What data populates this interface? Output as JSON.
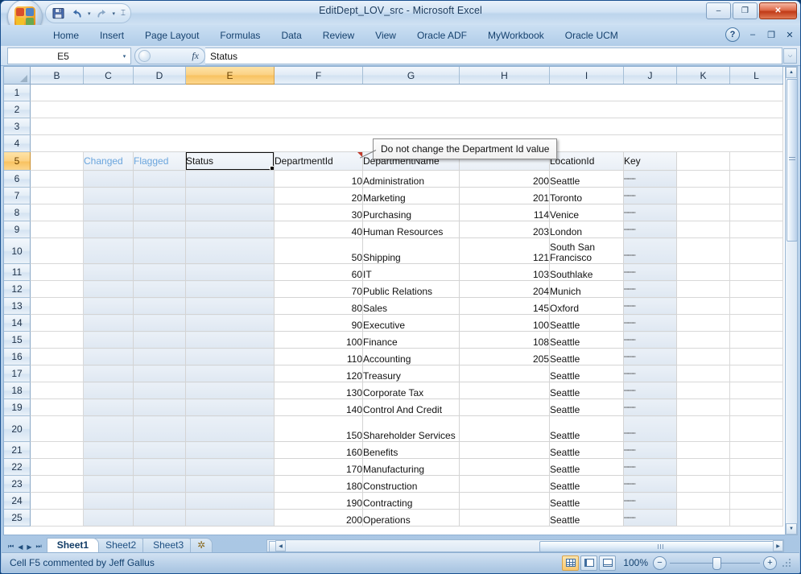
{
  "window": {
    "title": "EditDept_LOV_src - Microsoft Excel",
    "minimize_label": "–",
    "restore_label": "❐",
    "close_label": "✕"
  },
  "quick_access": {
    "office_button": "Office",
    "save_label": "💾",
    "undo_label": "↶",
    "redo_label": "↷",
    "caret_label": "▾",
    "customize_label": "☰"
  },
  "ribbon": {
    "tabs": [
      {
        "label": "Home",
        "active": false
      },
      {
        "label": "Insert",
        "active": false
      },
      {
        "label": "Page Layout",
        "active": false
      },
      {
        "label": "Formulas",
        "active": false
      },
      {
        "label": "Data",
        "active": false
      },
      {
        "label": "Review",
        "active": false
      },
      {
        "label": "View",
        "active": false
      },
      {
        "label": "Oracle ADF",
        "active": false
      },
      {
        "label": "MyWorkbook",
        "active": false
      },
      {
        "label": "Oracle UCM",
        "active": false
      }
    ],
    "help_label": "?",
    "minimize_ribbon_label": "–",
    "restore_ribbon_label": "❐",
    "close_ribbon_label": "✕"
  },
  "formula_bar": {
    "name_box_value": "E5",
    "name_box_arrow": "▾",
    "fx_label": "fx",
    "content": "Status",
    "expand_label": "⌵"
  },
  "grid": {
    "select_all_label": "",
    "columns": [
      "B",
      "C",
      "D",
      "E",
      "F",
      "G",
      "H",
      "I",
      "J",
      "K",
      "L"
    ],
    "selected_column": "E",
    "selected_row": 5,
    "rows": [
      {
        "n": 1,
        "cells": {}
      },
      {
        "n": 2,
        "cells": {}
      },
      {
        "n": 3,
        "cells": {}
      },
      {
        "n": 4,
        "cells": {}
      },
      {
        "n": 5,
        "cells": {
          "C": "Changed",
          "D": "Flagged",
          "E": "Status",
          "F": "DepartmentId",
          "G": "DepartmentName",
          "I": "LocationId",
          "J": "Key"
        }
      },
      {
        "n": 6,
        "cells": {
          "F": "10",
          "G": "Administration",
          "H": "200",
          "I": "Seattle",
          "J": "••••••••••••"
        }
      },
      {
        "n": 7,
        "cells": {
          "F": "20",
          "G": "Marketing",
          "H": "201",
          "I": "Toronto",
          "J": "••••••••••••"
        }
      },
      {
        "n": 8,
        "cells": {
          "F": "30",
          "G": "Purchasing",
          "H": "114",
          "I": "Venice",
          "J": "••••••••••••"
        }
      },
      {
        "n": 9,
        "cells": {
          "F": "40",
          "G": "Human Resources",
          "H": "203",
          "I": "London",
          "J": "••••••••••••"
        }
      },
      {
        "n": 10,
        "cells": {
          "F": "50",
          "G": "Shipping",
          "H": "121",
          "I": "South San Francisco",
          "J": "••••••••••••"
        }
      },
      {
        "n": 11,
        "cells": {
          "F": "60",
          "G": "IT",
          "H": "103",
          "I": "Southlake",
          "J": "••••••••••••"
        }
      },
      {
        "n": 12,
        "cells": {
          "F": "70",
          "G": "Public Relations",
          "H": "204",
          "I": "Munich",
          "J": "••••••••••••"
        }
      },
      {
        "n": 13,
        "cells": {
          "F": "80",
          "G": "Sales",
          "H": "145",
          "I": "Oxford",
          "J": "••••••••••••"
        }
      },
      {
        "n": 14,
        "cells": {
          "F": "90",
          "G": "Executive",
          "H": "100",
          "I": "Seattle",
          "J": "••••••••••••"
        }
      },
      {
        "n": 15,
        "cells": {
          "F": "100",
          "G": "Finance",
          "H": "108",
          "I": "Seattle",
          "J": "••••••••••••"
        }
      },
      {
        "n": 16,
        "cells": {
          "F": "110",
          "G": "Accounting",
          "H": "205",
          "I": "Seattle",
          "J": "••••••••••••"
        }
      },
      {
        "n": 17,
        "cells": {
          "F": "120",
          "G": "Treasury",
          "H": "",
          "I": "Seattle",
          "J": "••••••••••••"
        }
      },
      {
        "n": 18,
        "cells": {
          "F": "130",
          "G": "Corporate Tax",
          "H": "",
          "I": "Seattle",
          "J": "••••••••••••"
        }
      },
      {
        "n": 19,
        "cells": {
          "F": "140",
          "G": "Control And Credit",
          "H": "",
          "I": "Seattle",
          "J": "••••••••••••"
        }
      },
      {
        "n": 20,
        "cells": {
          "F": "150",
          "G": "Shareholder Services",
          "H": "",
          "I": "Seattle",
          "J": "••••••••••••"
        }
      },
      {
        "n": 21,
        "cells": {
          "F": "160",
          "G": "Benefits",
          "H": "",
          "I": "Seattle",
          "J": "••••••••••••"
        }
      },
      {
        "n": 22,
        "cells": {
          "F": "170",
          "G": "Manufacturing",
          "H": "",
          "I": "Seattle",
          "J": "••••••••••••"
        }
      },
      {
        "n": 23,
        "cells": {
          "F": "180",
          "G": "Construction",
          "H": "",
          "I": "Seattle",
          "J": "••••••••••••"
        }
      },
      {
        "n": 24,
        "cells": {
          "F": "190",
          "G": "Contracting",
          "H": "",
          "I": "Seattle",
          "J": "••••••••••••"
        }
      },
      {
        "n": 25,
        "cells": {
          "F": "200",
          "G": "Operations",
          "H": "",
          "I": "Seattle",
          "J": "••••••••••••"
        }
      }
    ]
  },
  "comment_tooltip": {
    "text": "Do not change the Department Id value",
    "anchor_cell": "F5"
  },
  "sheet_tabs": {
    "first_label": "⏮",
    "prev_label": "◀",
    "next_label": "▶",
    "last_label": "⏭",
    "tabs": [
      {
        "label": "Sheet1",
        "active": true
      },
      {
        "label": "Sheet2",
        "active": false
      },
      {
        "label": "Sheet3",
        "active": false
      }
    ],
    "insert_sheet_label": "✲"
  },
  "scrollbars": {
    "up_label": "▲",
    "down_label": "▼",
    "left_label": "◀",
    "right_label": "▶"
  },
  "status_bar": {
    "message": "Cell F5 commented by Jeff Gallus",
    "zoom_level": "100%",
    "zoom_out_label": "−",
    "zoom_in_label": "+",
    "view_normal": "normal-view",
    "view_layout": "page-layout-view",
    "view_break": "page-break-view"
  },
  "colors": {
    "selection_orange": "#f8c260",
    "header_blue": "#6aa5dd",
    "status_text": "#12406e"
  }
}
